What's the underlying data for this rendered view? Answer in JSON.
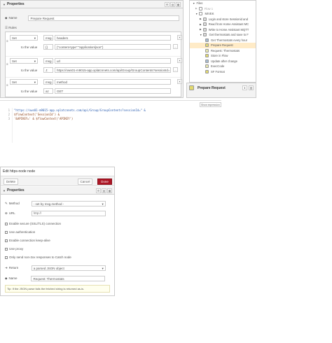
{
  "top_editor": {
    "tab_label": "Properties",
    "name_label": "Name",
    "name_value": "Prepare Request",
    "rules_label": "Rules",
    "to_value_label": "to the value",
    "rules": [
      {
        "action": "Set",
        "target_type": "msg.",
        "target": "headers",
        "value_type": "{}",
        "value": "{\"content-type\":\"application/json\"}"
      },
      {
        "action": "Set",
        "target_type": "msg.",
        "target": "url",
        "value_type": "J:",
        "value": "https://ows01-m9015-app.xplatcnnets.com/api/Group/GroupContents?sessionId= & $..."
      },
      {
        "action": "Set",
        "target_type": "msg.",
        "target": "method",
        "value_type": "az",
        "value": "GET"
      }
    ]
  },
  "file_tree": {
    "title": "Files",
    "items": [
      {
        "label": "Flow 1",
        "kind": "flow",
        "dim": true
      },
      {
        "label": "MIVEK",
        "kind": "flow",
        "dim": false
      },
      {
        "label": "Login and store Sessionid and",
        "kind": "node",
        "color": "#d9d9d9"
      },
      {
        "label": "Read from Home Assistant MC",
        "kind": "node",
        "color": "#d9d9d9"
      },
      {
        "label": "Write to Home Assistant MQTT",
        "kind": "node",
        "color": "#d9d9d9"
      },
      {
        "label": "Get thermostats and save to F",
        "kind": "node",
        "color": "#d9d9d9"
      },
      {
        "label": "Get Thermostats every hour",
        "kind": "subnode",
        "color": "#a6bbcf"
      },
      {
        "label": "Prepare Request",
        "kind": "subnode",
        "color": "#e2d96e",
        "selected": true
      },
      {
        "label": "Request: Thermostats",
        "kind": "subnode",
        "color": "#e7e7ae"
      },
      {
        "label": "Store in Flow",
        "kind": "subnode",
        "color": "#e2d96e"
      },
      {
        "label": "Update after change",
        "kind": "subnode",
        "color": "#a6bbcf"
      },
      {
        "label": "ExecCode",
        "kind": "subnode",
        "color": "#e7e7ae"
      },
      {
        "label": "SF Format",
        "kind": "subnode",
        "color": "#e2d96e"
      }
    ]
  },
  "info_panel": {
    "node_label": "Prepare Request"
  },
  "code_editor": {
    "expand_label": "Show expression",
    "lines": [
      {
        "num": "1",
        "text": "\"https://ows01-m9015-app.xplatcnnets.com/api/Group/GroupContents?sessionId=\" &"
      },
      {
        "num": "2",
        "text": "$flowContext('SessionId') &"
      },
      {
        "num": "3",
        "text": "'&APIKEY=' & $flowContext('APIKEY')"
      }
    ]
  },
  "http_editor": {
    "title": "Edit https-node node",
    "delete_label": "Delete",
    "cancel_label": "Cancel",
    "done_label": "Done",
    "tab_label": "Properties",
    "method_label": "Method",
    "method_value": "- set by msg.method -",
    "url_label": "URL",
    "url_placeholder": "http://",
    "checkboxes": [
      "Enable secure (SSL/TLS) connection",
      "Use authentication",
      "Enable connection keep-alive",
      "Use proxy",
      "Only send non-2xx responses to Catch node"
    ],
    "return_label": "Return",
    "return_value": "a parsed JSON object",
    "name_label": "Name",
    "name_value": "Request: Thermostats",
    "tip": "Tip: If the JSON parse fails the fetched string is returned as-is."
  },
  "colors": {
    "done": "#ad1625",
    "selected_row": "#ffebc7",
    "accent_code": "#2a5db0"
  }
}
